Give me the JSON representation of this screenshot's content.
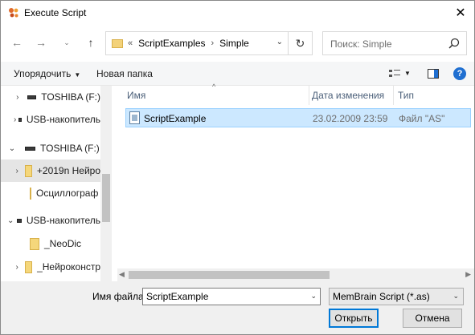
{
  "window": {
    "title": "Execute Script"
  },
  "nav": {
    "breadcrumbs": [
      "ScriptExamples",
      "Simple"
    ],
    "breadcrumb_prefix": "«",
    "search_placeholder": "Поиск: Simple"
  },
  "toolbar": {
    "organize_label": "Упорядочить",
    "new_folder_label": "Новая папка"
  },
  "tree": {
    "items": [
      {
        "label": "TOSHIBA (F:)",
        "type": "drive",
        "chevron": "›",
        "indent": 1
      },
      {
        "label": "USB-накопитель",
        "type": "drive",
        "chevron": "›",
        "indent": 1
      },
      {
        "label": "TOSHIBA (F:)",
        "type": "drive",
        "chevron": "⌄",
        "indent": 0
      },
      {
        "label": "+2019n Нейро",
        "type": "folder",
        "chevron": "›",
        "indent": 1,
        "selected": true
      },
      {
        "label": "Осциллограф S",
        "type": "folder",
        "chevron": "",
        "indent": 1
      },
      {
        "label": "USB-накопитель",
        "type": "drive",
        "chevron": "⌄",
        "indent": 0
      },
      {
        "label": "_NeoDic",
        "type": "folder",
        "chevron": "",
        "indent": 1
      },
      {
        "label": "_Нейроконстр",
        "type": "folder",
        "chevron": "›",
        "indent": 1
      }
    ]
  },
  "columns": {
    "name": "Имя",
    "date": "Дата изменения",
    "type": "Тип"
  },
  "files": [
    {
      "name": "ScriptExample",
      "date": "23.02.2009 23:59",
      "type": "Файл \"AS\""
    }
  ],
  "bottom": {
    "filename_label": "Имя файла:",
    "filename_value": "ScriptExample",
    "filetype_value": "MemBrain Script (*.as)",
    "open_label": "Открыть",
    "cancel_label": "Отмена"
  },
  "colors": {
    "selection": "#cce8ff",
    "accent": "#0078d7",
    "help": "#1f6fd1"
  }
}
